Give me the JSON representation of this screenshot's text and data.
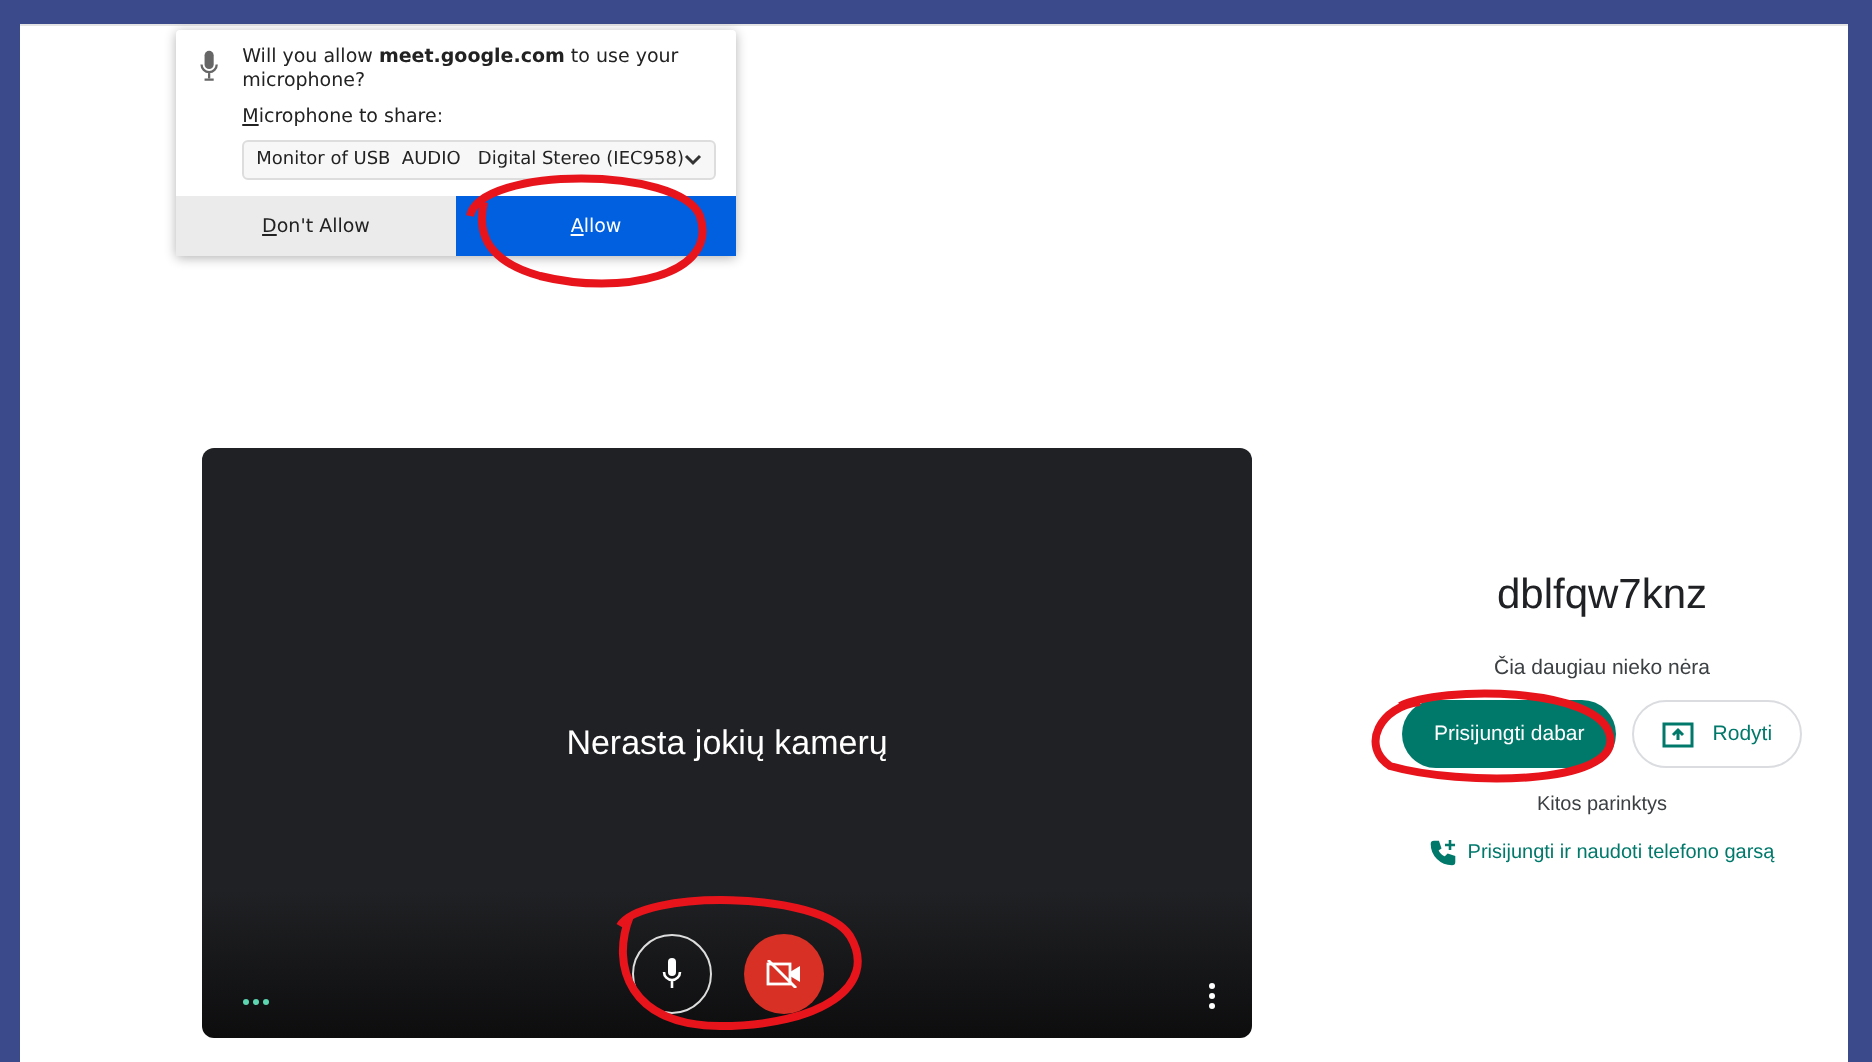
{
  "permission_popup": {
    "question": "Will you allow **meet.google.com** to use your microphone?",
    "device_label": "Microphone to share:",
    "device_select": "Monitor of USB  AUDIO   Digital Stereo (IEC958)",
    "buttons": [
      {
        "label": "Don't Allow",
        "kind": "secondary"
      },
      {
        "label": "Allow",
        "kind": "primary"
      }
    ]
  },
  "video_preview": {
    "message": "Nerasta jokių kamerų",
    "microphone_on": true,
    "camera_on": false
  },
  "meeting": {
    "code": "dblfqw7knz",
    "status": "Čia daugiau nieko nėra",
    "join_button": "Prisijungti dabar",
    "present_button": "Rodyti",
    "other_options": "Kitos parinktys",
    "phone_link": "Prisijungti ir naudoti telefono garsą"
  }
}
